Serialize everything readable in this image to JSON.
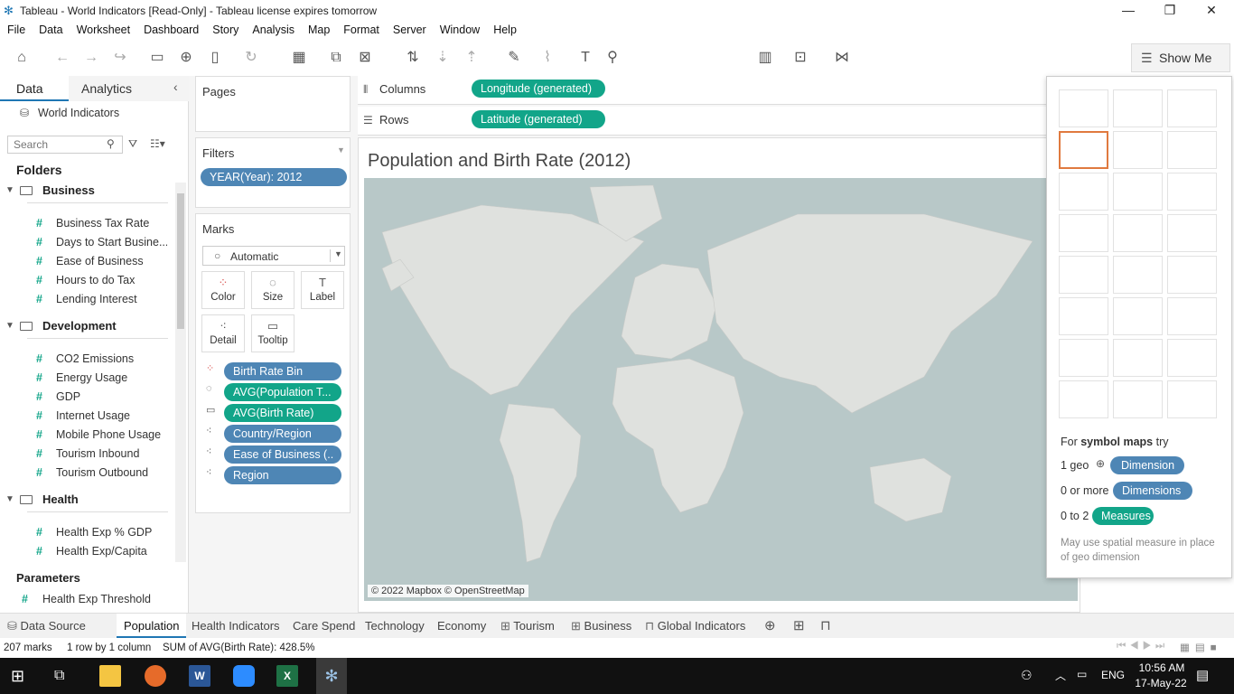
{
  "window": {
    "title": "Tableau - World Indicators [Read-Only] - Tableau license expires tomorrow"
  },
  "menu": [
    "File",
    "Data",
    "Worksheet",
    "Dashboard",
    "Story",
    "Analysis",
    "Map",
    "Format",
    "Server",
    "Window",
    "Help"
  ],
  "toolbar": {
    "showme_label": "Show Me"
  },
  "left_pane": {
    "tab_data": "Data",
    "tab_analytics": "Analytics",
    "datasource": "World Indicators",
    "search_placeholder": "Search",
    "folders_heading": "Folders",
    "folders": [
      {
        "name": "Business",
        "fields": [
          "Business Tax Rate",
          "Days to Start Busine...",
          "Ease of Business",
          "Hours to do Tax",
          "Lending Interest"
        ]
      },
      {
        "name": "Development",
        "fields": [
          "CO2 Emissions",
          "Energy Usage",
          "GDP",
          "Internet Usage",
          "Mobile Phone Usage",
          "Tourism Inbound",
          "Tourism Outbound"
        ]
      },
      {
        "name": "Health",
        "fields": [
          "Health Exp % GDP",
          "Health Exp/Capita"
        ]
      }
    ],
    "parameters_heading": "Parameters",
    "parameters": [
      "Health Exp Threshold"
    ]
  },
  "shelves": {
    "pages_label": "Pages",
    "filters_label": "Filters",
    "filters": [
      "YEAR(Year): 2012"
    ],
    "marks_label": "Marks",
    "mark_type": "Automatic",
    "mark_buttons": [
      "Color",
      "Size",
      "Label",
      "Detail",
      "Tooltip"
    ],
    "mark_fields": [
      "Birth Rate Bin",
      "AVG(Population T...",
      "AVG(Birth Rate)",
      "Country/Region",
      "Ease of Business (..",
      "Region"
    ],
    "columns_label": "Columns",
    "columns_pill": "Longitude (generated)",
    "rows_label": "Rows",
    "rows_pill": "Latitude (generated)"
  },
  "view": {
    "title": "Population and Birth Rate (2012)",
    "attribution": "© 2022 Mapbox © OpenStreetMap"
  },
  "showme": {
    "hint_prefix": "For",
    "hint_bold": "symbol maps",
    "hint_suffix": "try",
    "req1_count": "1 geo",
    "req1_pill": "Dimension",
    "req2_count": "0 or more",
    "req2_pill": "Dimensions",
    "req3_count": "0 to 2",
    "req3_pill": "Measures",
    "note": "May use spatial measure in place of geo dimension"
  },
  "sheet_tabs": [
    "Data Source",
    "Population",
    "Health Indicators",
    "Care Spend",
    "Technology",
    "Economy",
    "Tourism",
    "Business",
    "Global Indicators"
  ],
  "active_tab": "Population",
  "status": {
    "marks": "207 marks",
    "rows_cols": "1 row by 1 column",
    "sum": "SUM of AVG(Birth Rate): 428.5%"
  },
  "taskbar": {
    "time": "10:56 AM",
    "date": "17-May-22",
    "lang": "ENG"
  },
  "colors": {
    "accent_blue": "#4e86b5",
    "measure_green": "#12a589",
    "high_red": "#d9534f",
    "mid_grey": "#b0a7a2",
    "selected_orange": "#e07a3f"
  }
}
